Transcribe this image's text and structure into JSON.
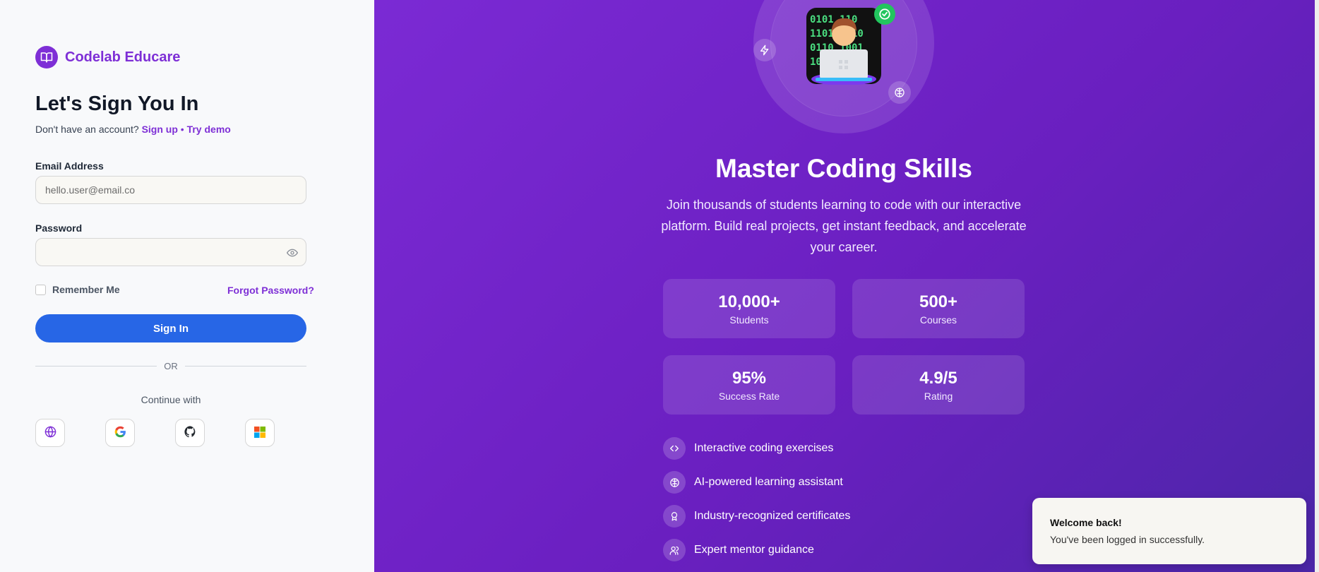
{
  "brand": {
    "name": "Codelab Educare",
    "icon": "book-open-icon",
    "color": "#7e2fd6"
  },
  "signin_form": {
    "title": "Let's Sign You In",
    "no_account_text": "Don't have an account?",
    "signup_link": "Sign up",
    "separator": "•",
    "demo_link": "Try demo",
    "email_label": "Email Address",
    "email_placeholder": "hello.user@email.co",
    "email_value": "",
    "password_label": "Password",
    "password_value": "",
    "remember_label": "Remember Me",
    "remember_checked": false,
    "forgot_link": "Forgot Password?",
    "submit_label": "Sign In",
    "divider_text": "OR",
    "continue_text": "Continue with",
    "social_providers": [
      "web",
      "google",
      "github",
      "microsoft"
    ],
    "primary_color": "#2766e6"
  },
  "hero": {
    "title": "Master Coding Skills",
    "description": "Join thousands of students learning to code with our interactive platform. Build real projects, get instant feedback, and accelerate your career.",
    "image": "coder-at-laptop-emoji",
    "stats": [
      {
        "value": "10,000+",
        "label": "Students"
      },
      {
        "value": "500+",
        "label": "Courses"
      },
      {
        "value": "95%",
        "label": "Success Rate"
      },
      {
        "value": "4.9/5",
        "label": "Rating"
      }
    ],
    "features": [
      {
        "icon": "code-icon",
        "text": "Interactive coding exercises"
      },
      {
        "icon": "brain-icon",
        "text": "AI-powered learning assistant"
      },
      {
        "icon": "award-icon",
        "text": "Industry-recognized certificates"
      },
      {
        "icon": "users-icon",
        "text": "Expert mentor guidance"
      }
    ],
    "gradient_colors": [
      "#7b2ad4",
      "#6a1fc0",
      "#4b26a8"
    ]
  },
  "toast": {
    "title": "Welcome back!",
    "message": "You've been logged in successfully."
  }
}
